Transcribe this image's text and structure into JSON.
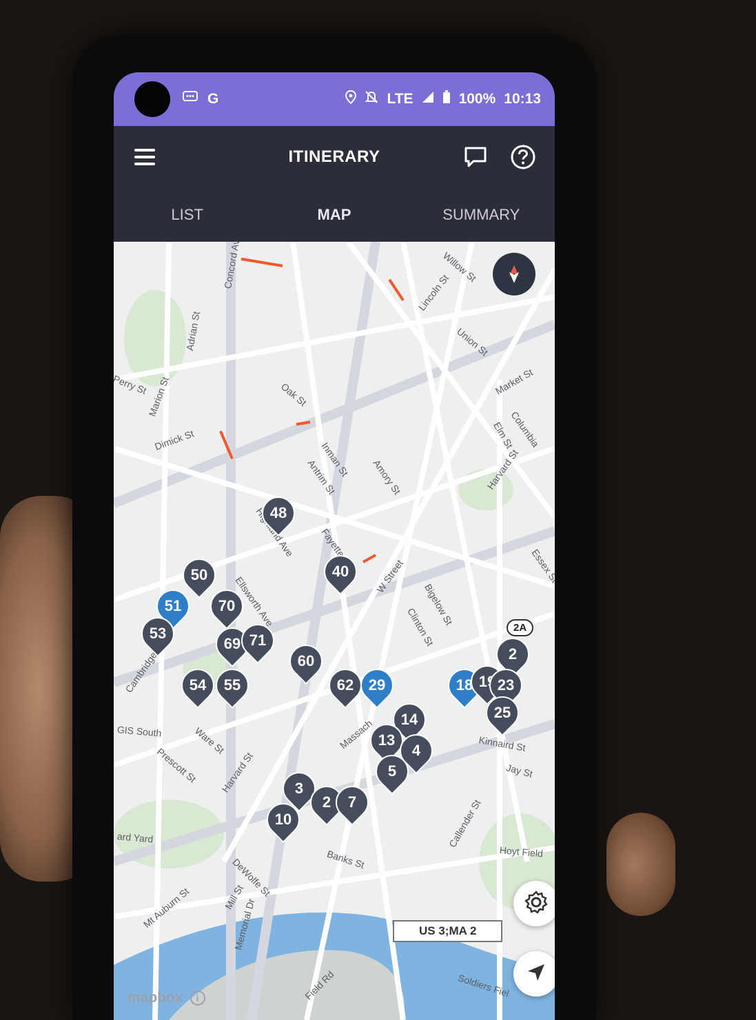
{
  "status_bar": {
    "left_icons": [
      "message-notification-icon",
      "google-g-icon"
    ],
    "google_label": "G",
    "network": "LTE",
    "battery": "100%",
    "time": "10:13"
  },
  "header": {
    "title": "ITINERARY",
    "menu_icon": "hamburger-menu-icon",
    "feedback_icon": "chat-bubble-icon",
    "help_icon": "help-circle-icon"
  },
  "tabs": [
    {
      "label": "LIST",
      "active": false
    },
    {
      "label": "MAP",
      "active": true
    },
    {
      "label": "SUMMARY",
      "active": false
    }
  ],
  "map": {
    "street_labels": [
      "Willow St",
      "Lincoln St",
      "Union St",
      "Concord Ave",
      "Adrian St",
      "Perry St",
      "Marion St",
      "Dimick St",
      "Oak St",
      "Market St",
      "Columbia",
      "Elm St",
      "Inman St",
      "Antrim St",
      "Amory St",
      "Harvard St",
      "Fayette St",
      "Highland Ave",
      "W Street",
      "Essex St",
      "Ellsworth Ave",
      "Bigelow St",
      "Clinton St",
      "Cambridge St",
      "Ware St",
      "Prescott St",
      "Harvard St",
      "Massach",
      "Kinnaird St",
      "Jay St",
      "Banks St",
      "Callender St",
      "DeWolfe St",
      "Mt Auburn St",
      "Mill St",
      "Memorial Dr",
      "Field Rd",
      "Soldiers Fiel",
      "Hoyt Field",
      "GIS South",
      "ard Yard"
    ],
    "stops": [
      {
        "label": "50",
        "color": "gray"
      },
      {
        "label": "51",
        "color": "blue"
      },
      {
        "label": "53",
        "color": "gray"
      },
      {
        "label": "54",
        "color": "gray"
      },
      {
        "label": "55",
        "color": "gray"
      },
      {
        "label": "70",
        "color": "gray"
      },
      {
        "label": "69",
        "color": "gray"
      },
      {
        "label": "71",
        "color": "gray"
      },
      {
        "label": "60",
        "color": "gray"
      },
      {
        "label": "62",
        "color": "gray"
      },
      {
        "label": "29",
        "color": "blue"
      },
      {
        "label": "40",
        "color": "gray"
      },
      {
        "label": "48",
        "color": "gray"
      },
      {
        "label": "18",
        "color": "blue"
      },
      {
        "label": "19",
        "color": "gray"
      },
      {
        "label": "2",
        "color": "gray"
      },
      {
        "label": "23",
        "color": "gray"
      },
      {
        "label": "25",
        "color": "gray"
      },
      {
        "label": "14",
        "color": "gray"
      },
      {
        "label": "13",
        "color": "gray"
      },
      {
        "label": "4",
        "color": "gray"
      },
      {
        "label": "5",
        "color": "gray"
      },
      {
        "label": "3",
        "color": "gray"
      },
      {
        "label": "2",
        "color": "gray"
      },
      {
        "label": "7",
        "color": "gray"
      },
      {
        "label": "10",
        "color": "gray"
      }
    ],
    "route_shield": "US 3;MA 2",
    "route_badge": "2A",
    "attribution": "mapbox",
    "settings_icon": "gear-icon",
    "locate_icon": "navigation-arrow-icon",
    "compass_icon": "compass-icon"
  }
}
